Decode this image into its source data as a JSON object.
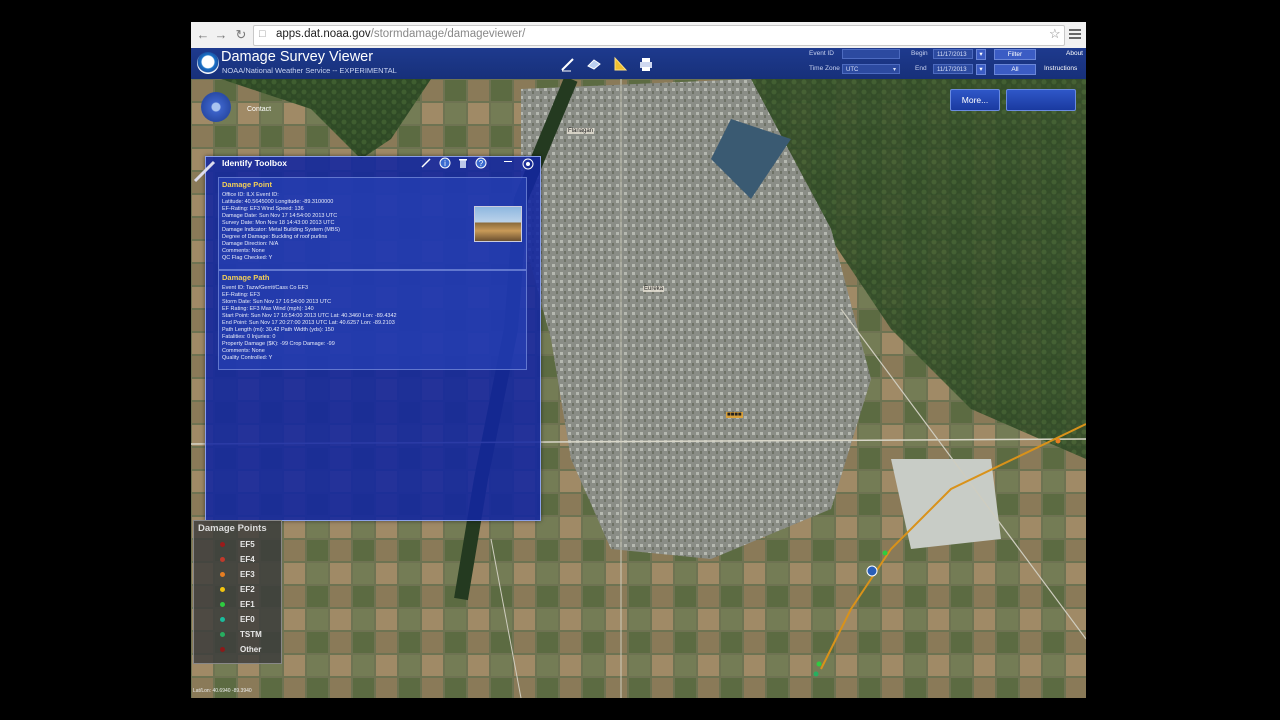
{
  "browser": {
    "url_host": "apps.dat.noaa.gov",
    "url_path": "/stormdamage/damageviewer/"
  },
  "header": {
    "title": "Damage Survey Viewer",
    "subtitle": "NOAA/National Weather Service -- EXPERIMENTAL",
    "event_id_label": "Event ID",
    "time_zone_label": "Time Zone",
    "time_zone_value": "UTC",
    "begin_label": "Begin",
    "end_label": "End",
    "begin_value": "11/17/2013",
    "end_value": "11/17/2013",
    "filter_button": "Filter",
    "all_button": "All",
    "about_link": "About",
    "instructions_link": "Instructions"
  },
  "map_buttons": {
    "more_label": "More...",
    "blank_label": ""
  },
  "map": {
    "contact_label": "Contact",
    "town_label_1": "Flanagan",
    "town_label_2": "Eureka",
    "attribution": "Lat/Lon: 40.6940 -89.3940"
  },
  "identify_panel": {
    "title": "Identify Toolbox",
    "damage_point": {
      "heading": "Damage Point",
      "lines": [
        "Office ID: ILX    Event ID:",
        "Latitude: 40.5645000   Longitude: -89.3100000",
        "EF-Rating: EF3   Wind Speed: 136",
        "Damage Date: Sun Nov 17 14:54:00 2013 UTC",
        "Survey Date: Mon Nov 18 14:43:00 2013 UTC",
        "Damage Indicator: Metal Building System (MBS)",
        "Degree of Damage: Buckling of roof purlins",
        "Damage Direction: N/A",
        "Comments: None",
        "QC Flag Checked: Y"
      ]
    },
    "damage_path": {
      "heading": "Damage Path",
      "lines": [
        "Event ID: Tazw/Gerrit/Cass Co EF3",
        "EF-Rating: EF3",
        "Storm Date: Sun Nov 17 16:54:00 2013 UTC",
        "EF Rating: EF3  Max Wind (mph): 140",
        "Start Point: Sun Nov 17 16:54:00 2013 UTC Lat: 40.3460 Lon: -89.4342",
        "End Point: Sun Nov 17 20:27:00 2013 UTC Lat: 40.6257 Lon: -89.2103",
        "Path Length (mi): 30.42  Path Width (yds): 150",
        "Fatalities: 0  Injuries: 0",
        "Property Damage ($K): -99  Crop Damage: -99",
        "Comments: None",
        "Quality Controlled: Y"
      ]
    }
  },
  "legend": {
    "title": "Damage Points",
    "items": [
      {
        "label": "EF5",
        "color": "#9a1b1b"
      },
      {
        "label": "EF4",
        "color": "#c0392b"
      },
      {
        "label": "EF3",
        "color": "#e67e22"
      },
      {
        "label": "EF2",
        "color": "#f1c40f"
      },
      {
        "label": "EF1",
        "color": "#2ecc40"
      },
      {
        "label": "EF0",
        "color": "#1abc9c"
      },
      {
        "label": "TSTM",
        "color": "#27ae60"
      },
      {
        "label": "Other",
        "color": "#8b1a1a"
      }
    ]
  }
}
